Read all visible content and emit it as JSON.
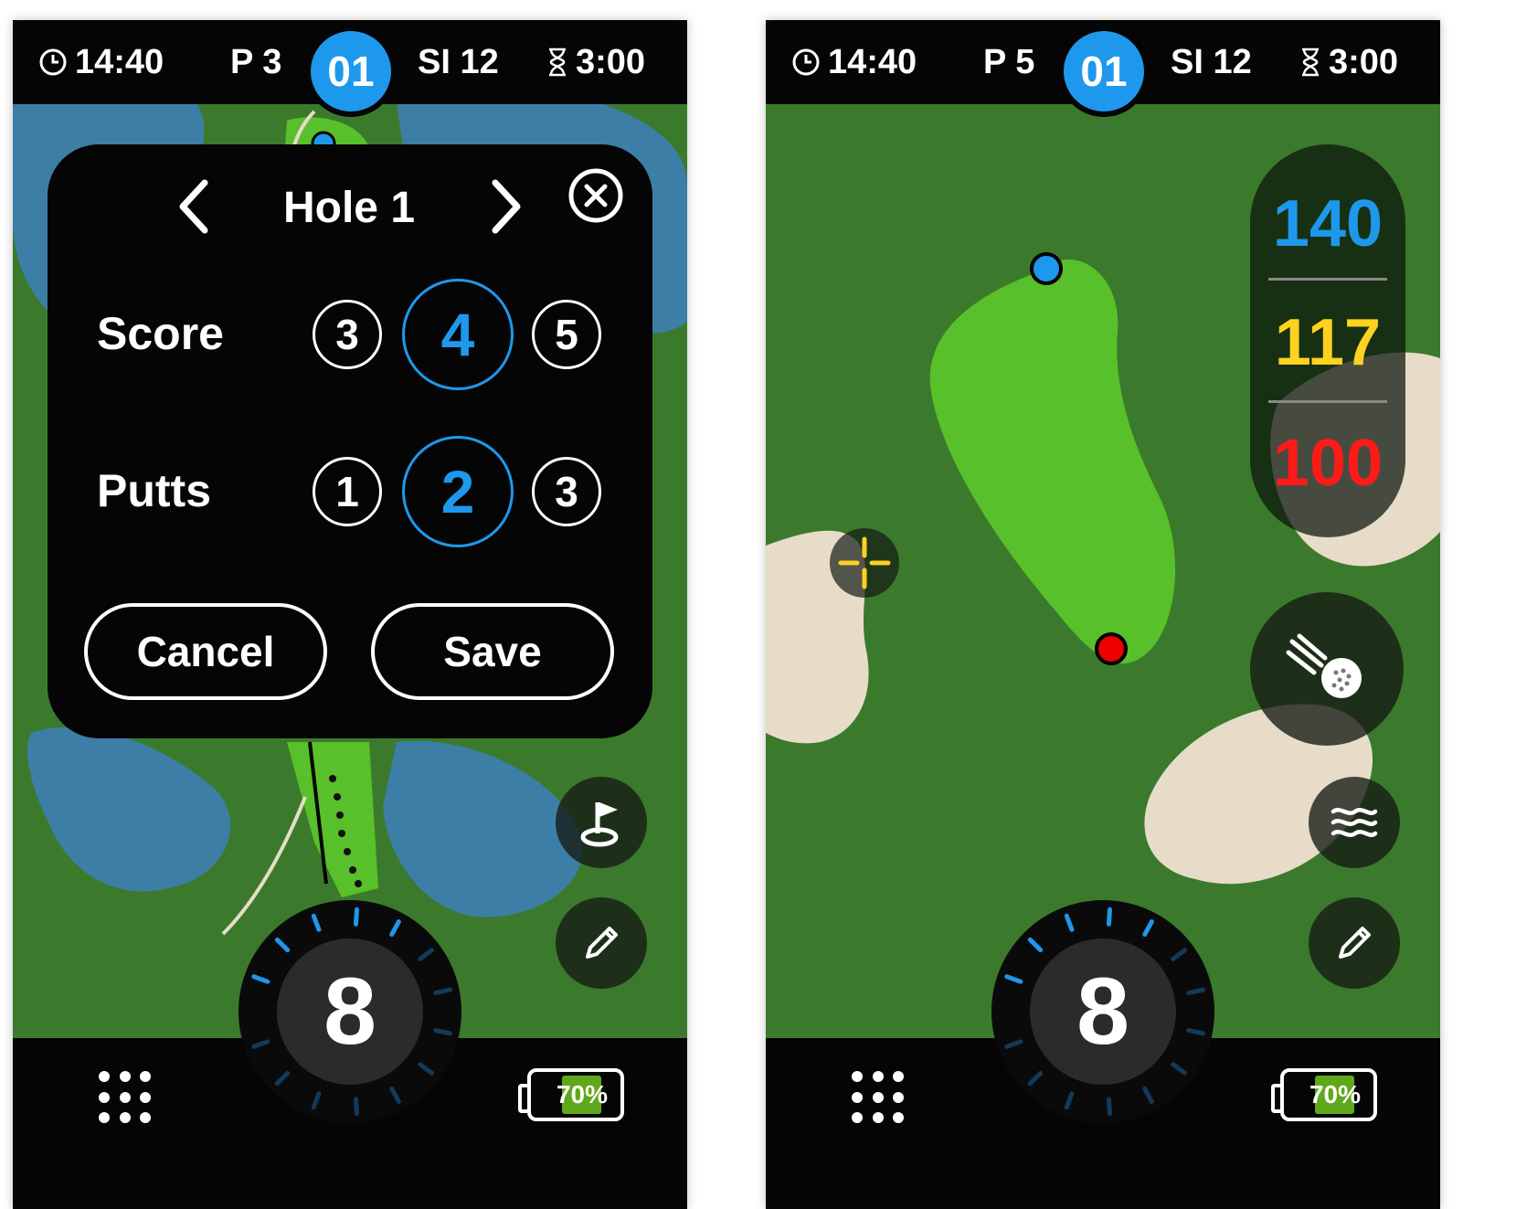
{
  "colors": {
    "accent_blue": "#1e98ec",
    "fairway_green": "#3b7a2c",
    "green_light": "#58c02a",
    "water_blue": "#3d7ea6",
    "bunker_sand": "#e6dcc8",
    "distance_front": "#ffd21f",
    "distance_back": "#ff1a1a",
    "battery_fill": "#5fa81b"
  },
  "left_screen": {
    "status_bar": {
      "time": "14:40",
      "par": "P 3",
      "hole_number": "01",
      "stroke_index": "SI 12",
      "timer": "3:00",
      "icons": [
        "clock-icon",
        "hourglass-icon"
      ]
    },
    "scorecard_dialog": {
      "title": "Hole 1",
      "prev_icon": "chevron-left-icon",
      "next_icon": "chevron-right-icon",
      "close_icon": "close-circle-icon",
      "score_label": "Score",
      "score_options": [
        "3",
        "4",
        "5"
      ],
      "score_selected": "4",
      "putts_label": "Putts",
      "putts_options": [
        "1",
        "2",
        "3"
      ],
      "putts_selected": "2",
      "cancel_label": "Cancel",
      "save_label": "Save"
    },
    "side_buttons": [
      "flag-icon",
      "pencil-icon"
    ],
    "club_dial": {
      "club": "8",
      "level": 0.35
    },
    "bottom_bar": {
      "menu_icon": "grid-menu-icon",
      "battery": "70%",
      "battery_level": 0.7
    }
  },
  "right_screen": {
    "status_bar": {
      "time": "14:40",
      "par": "P 5",
      "hole_number": "01",
      "stroke_index": "SI 12",
      "timer": "3:00",
      "icons": [
        "clock-icon",
        "hourglass-icon"
      ]
    },
    "distances": {
      "back": "140",
      "middle": "117",
      "front": "100"
    },
    "map_markers": [
      "pin-back-marker",
      "pin-front-marker",
      "target-crosshair-icon"
    ],
    "side_buttons": [
      "shot-tracking-icon",
      "wind-icon",
      "pencil-icon"
    ],
    "club_dial": {
      "club": "8",
      "level": 0.35
    },
    "bottom_bar": {
      "menu_icon": "grid-menu-icon",
      "battery": "70%",
      "battery_level": 0.7
    }
  }
}
